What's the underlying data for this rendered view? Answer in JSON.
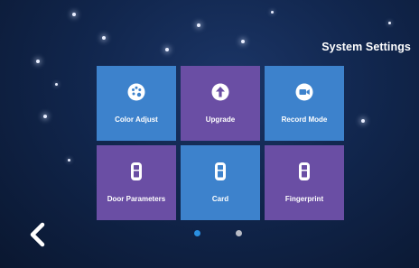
{
  "header": {
    "title": "System Settings"
  },
  "tiles": [
    {
      "label": "Color Adjust",
      "icon": "palette-icon",
      "color": "#3d82cc"
    },
    {
      "label": "Upgrade",
      "icon": "upload-arrow-icon",
      "color": "#6a4ea4"
    },
    {
      "label": "Record Mode",
      "icon": "video-camera-icon",
      "color": "#3d82cc"
    },
    {
      "label": "Door Parameters",
      "icon": "intercom-panel-icon",
      "color": "#6a4ea4"
    },
    {
      "label": "Card",
      "icon": "intercom-panel-icon",
      "color": "#3d82cc"
    },
    {
      "label": "Fingerprint",
      "icon": "intercom-panel-icon",
      "color": "#6a4ea4"
    }
  ],
  "pagination": {
    "pages": 2,
    "current": 1,
    "active_color": "#2a8fe0",
    "inactive_color": "#b9bcc6"
  },
  "back_button": {
    "icon": "chevron-left-icon"
  }
}
